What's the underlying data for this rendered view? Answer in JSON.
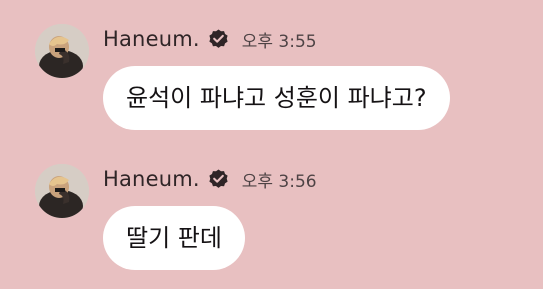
{
  "messages": [
    {
      "sender": "Haneum.",
      "verified_icon": "verified-check-badge-icon",
      "time": "오후 3:55",
      "text": "윤석이 파냐고 성훈이 파냐고?"
    },
    {
      "sender": "Haneum.",
      "verified_icon": "verified-check-badge-icon",
      "time": "오후 3:56",
      "text": "딸기 판데"
    }
  ],
  "colors": {
    "background": "#e8c0c1",
    "bubble": "#ffffff",
    "name": "#2f2527",
    "time": "#4e4345"
  }
}
